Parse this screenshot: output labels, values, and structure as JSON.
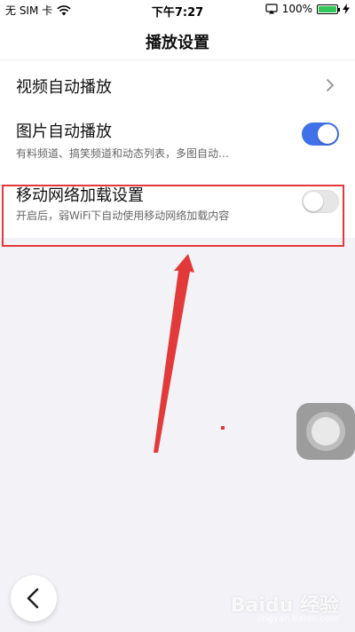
{
  "status_bar": {
    "carrier": "无 SIM 卡",
    "time": "下午7:27",
    "battery": "100%",
    "battery_level": 1.0
  },
  "nav": {
    "title": "播放设置"
  },
  "settings": {
    "video_autoplay": {
      "title": "视频自动播放"
    },
    "image_autoplay": {
      "title": "图片自动播放",
      "subtitle": "有料频道、搞笑频道和动态列表，多图自动…",
      "enabled": true
    },
    "mobile_network": {
      "title": "移动网络加载设置",
      "subtitle": "开启后，弱WiFi下自动使用移动网络加载内容",
      "enabled": false
    }
  },
  "colors": {
    "accent": "#3f72e8",
    "highlight": "#e23a3a",
    "arrow": "#e23a3a",
    "background": "#f2f2f7"
  },
  "icons": {
    "wifi": "wifi-icon",
    "airplay": "airplay-icon",
    "charging": "charging-bolt-icon",
    "chevron": "chevron-right-icon",
    "back": "chevron-left-icon"
  },
  "watermark": {
    "brand": "Baidu 经验",
    "url": "jingyan.baidu.com"
  }
}
